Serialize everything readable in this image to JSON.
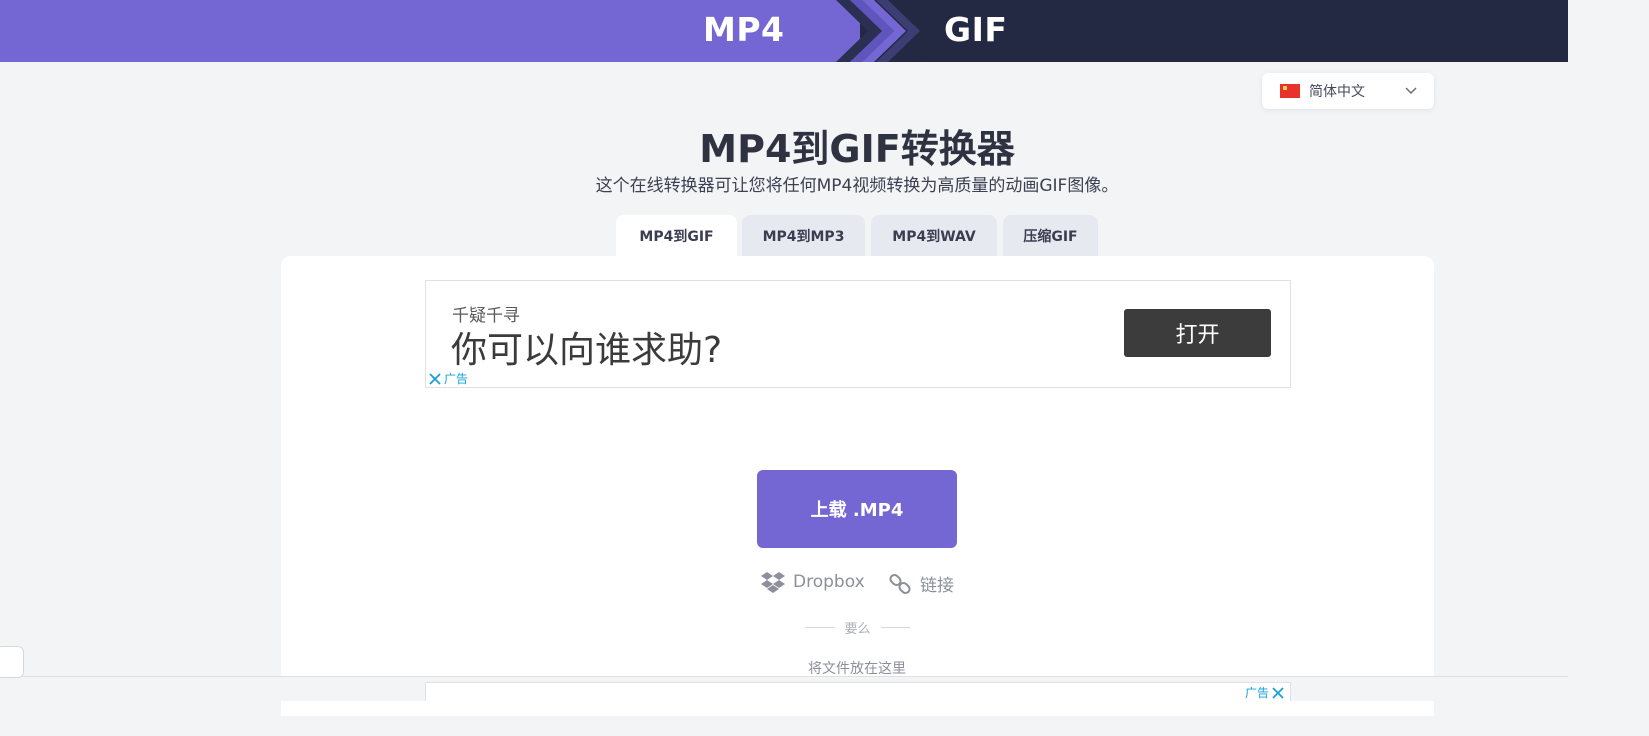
{
  "banner": {
    "from": "MP4",
    "to": "GIF"
  },
  "language": {
    "selected": "简体中文"
  },
  "heading": {
    "title": "MP4到GIF转换器",
    "subtitle": "这个在线转换器可让您将任何MP4视频转换为高质量的动画GIF图像。"
  },
  "tabs": [
    {
      "label": "MP4到GIF",
      "active": true
    },
    {
      "label": "MP4到MP3",
      "active": false
    },
    {
      "label": "MP4到WAV",
      "active": false
    },
    {
      "label": "压缩GIF",
      "active": false
    }
  ],
  "ad": {
    "small_text": "千疑千寻",
    "headline": "你可以向谁求助?",
    "button": "打开",
    "tag": "广告"
  },
  "upload": {
    "button": "上载 .MP4",
    "dropbox": "Dropbox",
    "link": "链接",
    "or": "要么",
    "drop_here": "将文件放在这里"
  },
  "bottom_ad": {
    "tag": "广告"
  },
  "colors": {
    "accent": "#7467d4",
    "dark": "#232843"
  }
}
